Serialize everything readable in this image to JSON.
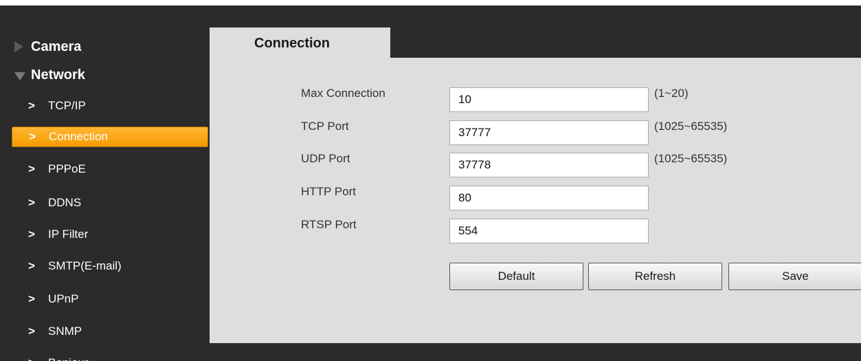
{
  "sidebar": {
    "sections": [
      {
        "label": "Camera",
        "expanded": false
      },
      {
        "label": "Network",
        "expanded": true
      }
    ],
    "items": [
      {
        "label": "TCP/IP"
      },
      {
        "label": "Connection",
        "active": true
      },
      {
        "label": "PPPoE"
      },
      {
        "label": "DDNS"
      },
      {
        "label": "IP Filter"
      },
      {
        "label": "SMTP(E-mail)"
      },
      {
        "label": "UPnP"
      },
      {
        "label": "SNMP"
      },
      {
        "label": "Bonjour"
      }
    ],
    "chevron": ">"
  },
  "tab": {
    "label": "Connection"
  },
  "form": {
    "max_connection": {
      "label": "Max Connection",
      "value": "10",
      "range": "(1~20)"
    },
    "tcp_port": {
      "label": "TCP Port",
      "value": "37777",
      "range": "(1025~65535)"
    },
    "udp_port": {
      "label": "UDP Port",
      "value": "37778",
      "range": "(1025~65535)"
    },
    "http_port": {
      "label": "HTTP Port",
      "value": "80"
    },
    "rtsp_port": {
      "label": "RTSP Port",
      "value": "554"
    }
  },
  "buttons": {
    "default": "Default",
    "refresh": "Refresh",
    "save": "Save"
  },
  "colors": {
    "active_item": "#f5a000",
    "background": "#2b2b2b",
    "panel": "#dedede"
  }
}
